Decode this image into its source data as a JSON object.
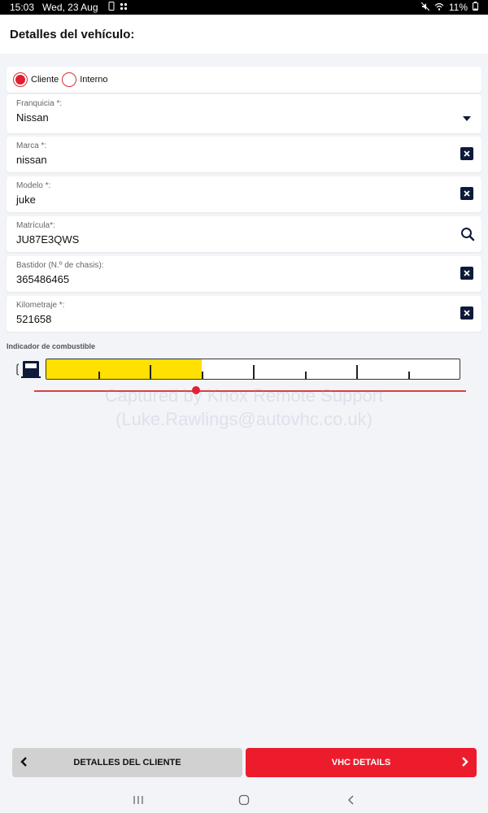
{
  "status_bar": {
    "time": "15:03",
    "date": "Wed, 23 Aug",
    "battery": "11%"
  },
  "header": {
    "title": "Detalles del vehículo:"
  },
  "customer_type": {
    "options": [
      "Cliente",
      "Interno"
    ],
    "selected": "Cliente"
  },
  "fields": [
    {
      "label": "Franquicia *:",
      "value": "Nissan",
      "icon": "dropdown-arrow-icon"
    },
    {
      "label": "Marca *:",
      "value": "nissan",
      "icon": "clear-icon"
    },
    {
      "label": "Modelo *:",
      "value": "juke",
      "icon": "clear-icon"
    },
    {
      "label": "Matrícula*:",
      "value": "JU87E3QWS",
      "icon": "search-icon"
    },
    {
      "label": "Bastidor (N.º de chasis):",
      "value": "365486465",
      "icon": "clear-icon"
    },
    {
      "label": "Kilometraje *:",
      "value": "521658",
      "icon": "clear-icon"
    }
  ],
  "fuel": {
    "label": "Indicador de combustible",
    "level": 0.375,
    "ticks": 8
  },
  "watermark": {
    "line1": "Captured by Knox Remote Support",
    "line2": "(Luke.Rawlings@autovhc.co.uk)"
  },
  "buttons": {
    "back_label": "DETALLES DEL CLIENTE",
    "next_label": "VHC DETAILS"
  },
  "colors": {
    "accent_red": "#ec1c2d",
    "fuel_yellow": "#ffe000",
    "icon_navy": "#0e1a3a"
  }
}
